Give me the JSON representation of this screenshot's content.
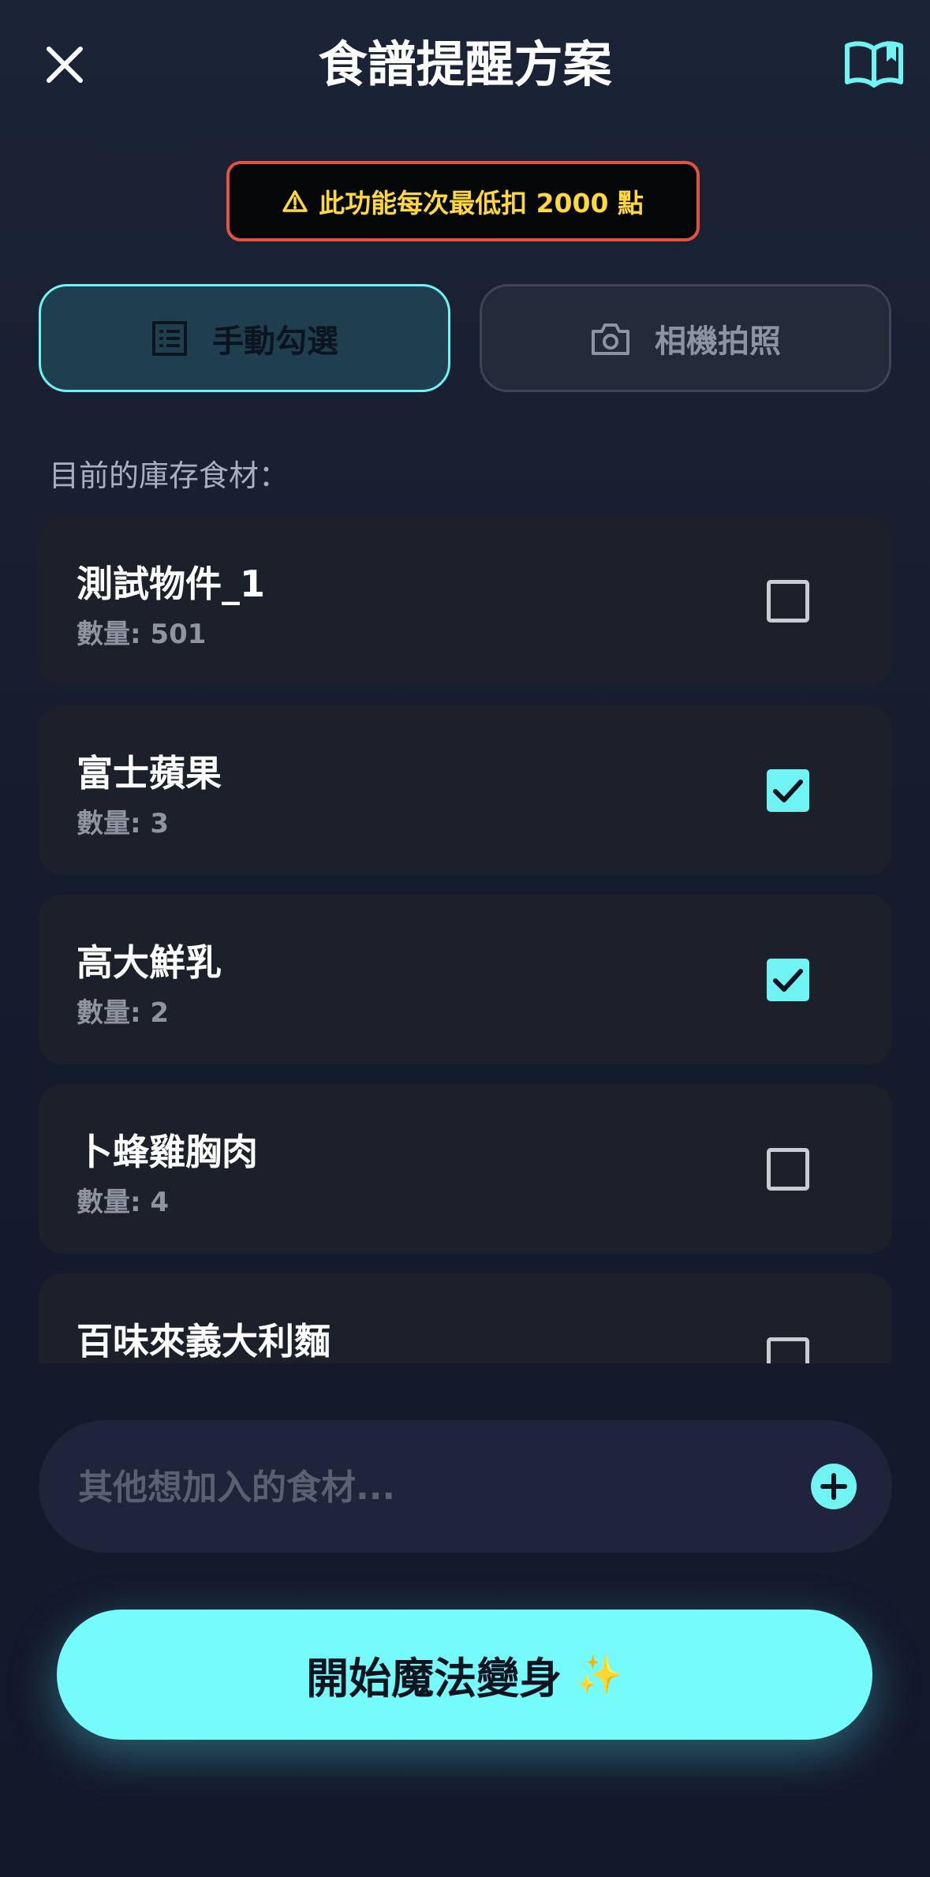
{
  "header": {
    "title": "食譜提醒方案"
  },
  "warning": {
    "text": "此功能每次最低扣 2000 點",
    "color": "#ffd93b",
    "border_color": "#e5533d"
  },
  "tabs": [
    {
      "label": "手動勾選",
      "icon": "list-icon",
      "active": true
    },
    {
      "label": "相機拍照",
      "icon": "camera-icon",
      "active": false
    }
  ],
  "inventory": {
    "label": "目前的庫存食材：",
    "items": [
      {
        "name": "測試物件_1",
        "qty": "數量: 501",
        "checked": false
      },
      {
        "name": "富士蘋果",
        "qty": "數量: 3",
        "checked": true
      },
      {
        "name": "高大鮮乳",
        "qty": "數量: 2",
        "checked": true
      },
      {
        "name": "卜蜂雞胸肉",
        "qty": "數量: 4",
        "checked": false
      },
      {
        "name": "百味來義大利麵",
        "qty": "",
        "checked": false
      }
    ]
  },
  "extra_input": {
    "placeholder": "其他想加入的食材...",
    "value": ""
  },
  "start_button": {
    "label": "開始魔法變身",
    "emoji": "✨"
  },
  "colors": {
    "accent": "#6ff3f3",
    "background": "#151c2e"
  }
}
